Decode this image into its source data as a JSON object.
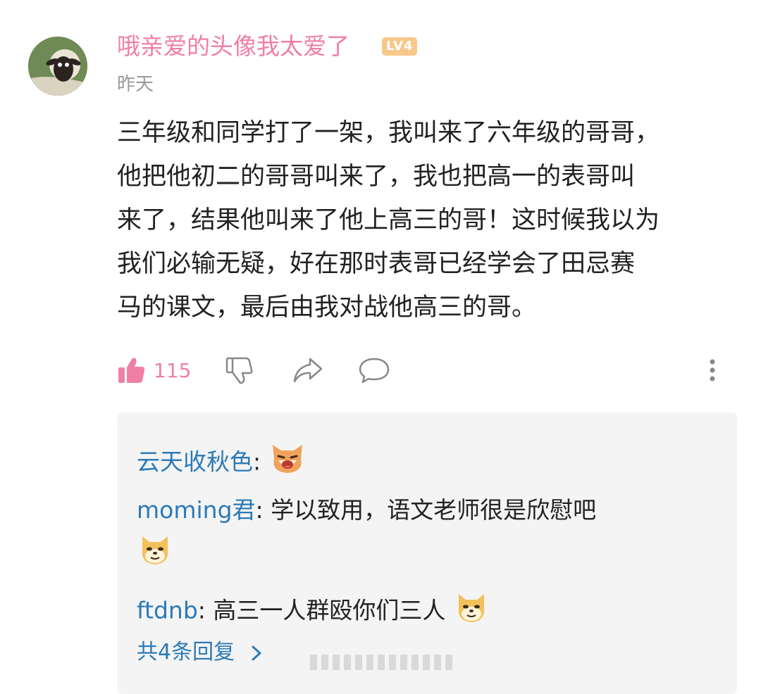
{
  "comment": {
    "username": "哦亲爱的头像我太爱了",
    "level": "LV4",
    "time": "昨天",
    "content": "三年级和同学打了一架，我叫来了六年级的哥哥，\n他把他初二的哥哥叫来了，我也把高一的表哥叫\n来了，结果他叫来了他上高三的哥！这时候我以为\n我们必输无疑，好在那时表哥已经学会了田忌赛\n马的课文，最后由我对战他高三的哥。",
    "like_count": "115",
    "icons": [
      "thumb-up-icon",
      "thumb-down-icon",
      "share-icon",
      "comment-icon",
      "more-vertical-icon"
    ],
    "colors": {
      "username": "#f07fa5",
      "reply_name": "#2b7ab8"
    }
  },
  "replies": {
    "items": [
      {
        "name": "云天收秋色",
        "sep": ": ",
        "text": "",
        "emoji": "laughing-shiba-emoji"
      },
      {
        "name": "moming君",
        "sep": ": ",
        "text": "学以致用，语文老师很是欣慰吧",
        "emoji": "doge-emoji"
      },
      {
        "name": "ftdnb",
        "sep": ": ",
        "text": "高三一人群殴你们三人",
        "emoji": "doge-emoji"
      }
    ],
    "more_label": "共4条回复",
    "more_icon": "chevron-right-icon"
  }
}
